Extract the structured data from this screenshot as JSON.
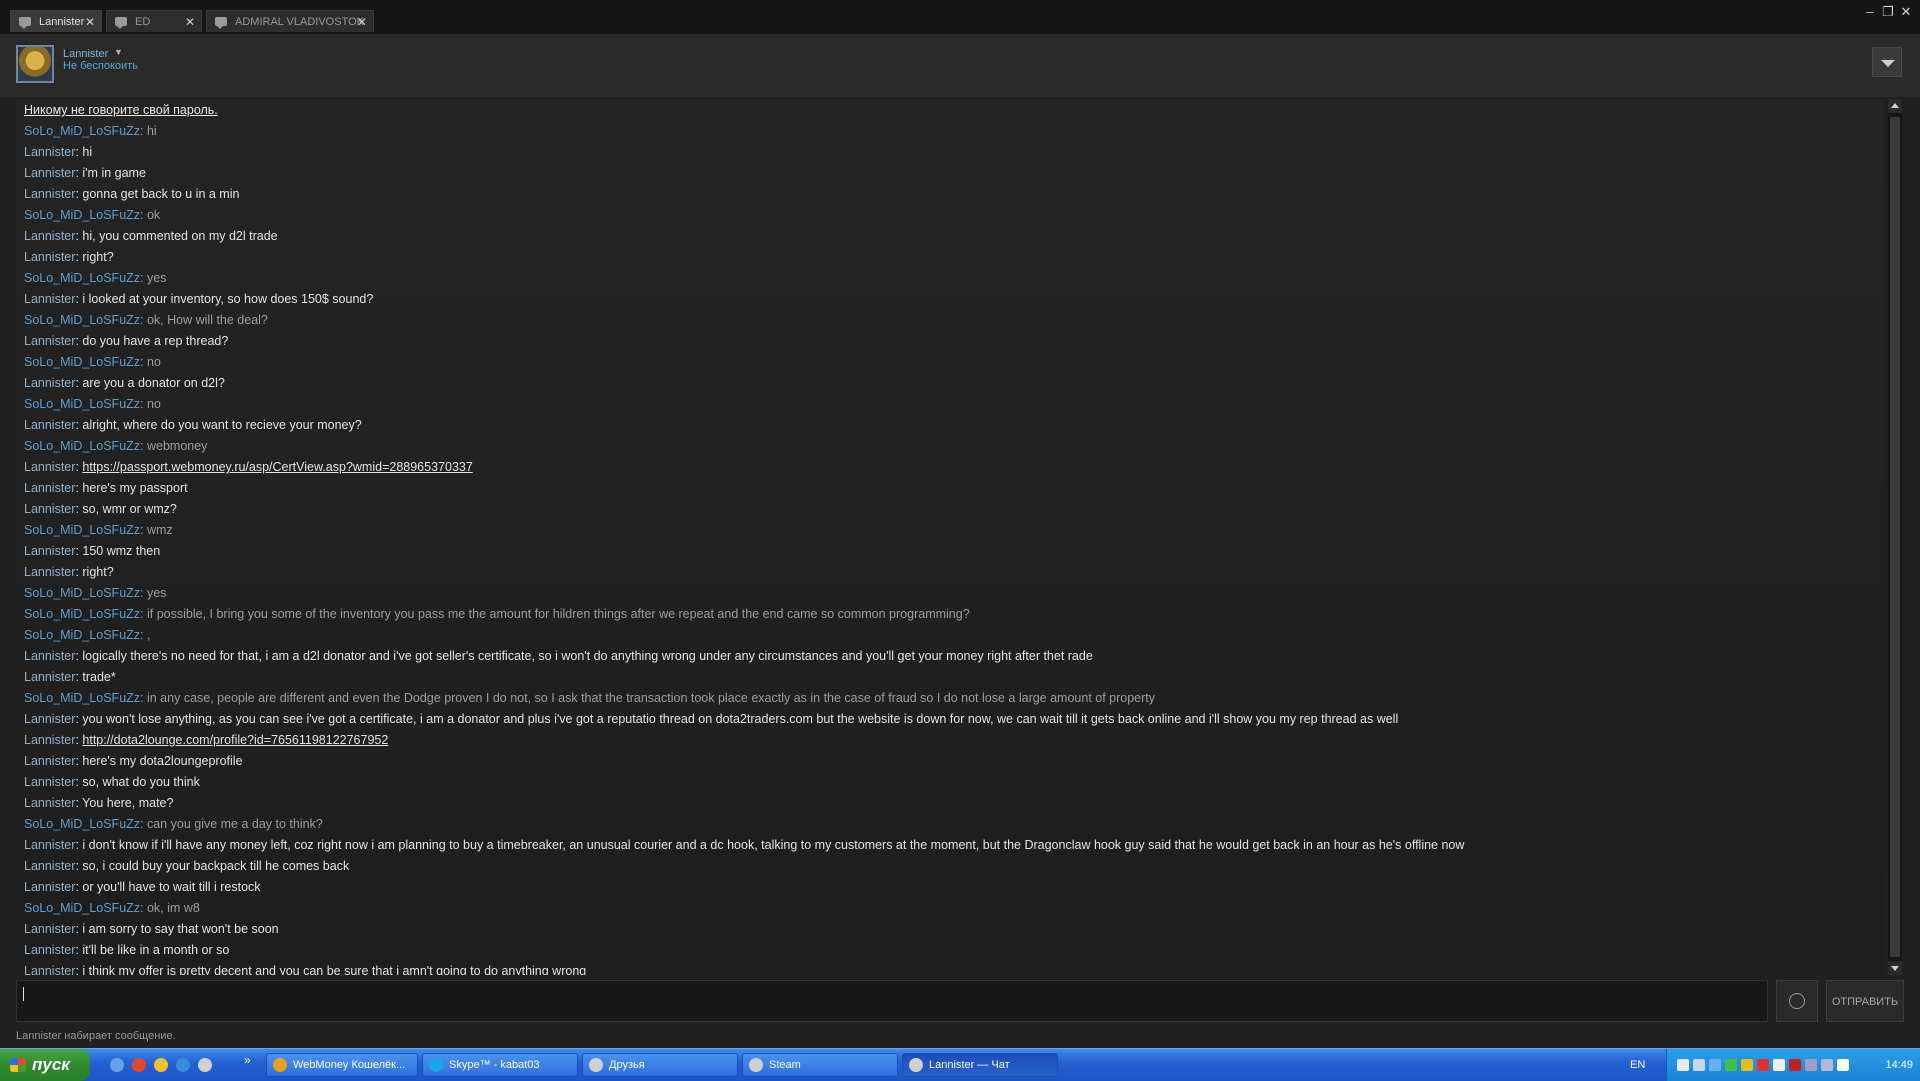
{
  "window": {
    "tabs": [
      {
        "label": "Lannister",
        "active": true
      },
      {
        "label": "ED",
        "active": false
      },
      {
        "label": "ADMIRAL VLADIVOSTOK",
        "active": false
      }
    ],
    "controls": {
      "minimize": "–",
      "maximize": "❐",
      "close": "✕"
    }
  },
  "header": {
    "username": "Lannister",
    "status": "Не беспокоить"
  },
  "chat": {
    "warning": "Никому не говорите свой пароль.",
    "messages": [
      {
        "from": "SoLo_MiD_LoSFuZz",
        "text": "hi"
      },
      {
        "from": "Lannister",
        "text": "hi"
      },
      {
        "from": "Lannister",
        "text": "i'm in game"
      },
      {
        "from": "Lannister",
        "text": "gonna get back to u in a min"
      },
      {
        "from": "SoLo_MiD_LoSFuZz",
        "text": "ok"
      },
      {
        "from": "Lannister",
        "text": "hi, you commented on my d2l trade"
      },
      {
        "from": "Lannister",
        "text": "right?"
      },
      {
        "from": "SoLo_MiD_LoSFuZz",
        "text": "yes"
      },
      {
        "from": "Lannister",
        "text": "i looked at your inventory, so how does 150$ sound?"
      },
      {
        "from": "SoLo_MiD_LoSFuZz",
        "text": "ok, How will the deal?"
      },
      {
        "from": "Lannister",
        "text": "do you have a rep thread?"
      },
      {
        "from": "SoLo_MiD_LoSFuZz",
        "text": "no"
      },
      {
        "from": "Lannister",
        "text": "are you a donator on d2l?"
      },
      {
        "from": "SoLo_MiD_LoSFuZz",
        "text": "no"
      },
      {
        "from": "Lannister",
        "text": "alright, where do you want to recieve your money?"
      },
      {
        "from": "SoLo_MiD_LoSFuZz",
        "text": "webmoney"
      },
      {
        "from": "Lannister",
        "text": "https://passport.webmoney.ru/asp/CertView.asp?wmid=288965370337",
        "link": true
      },
      {
        "from": "Lannister",
        "text": "here's my passport"
      },
      {
        "from": "Lannister",
        "text": "so, wmr or wmz?"
      },
      {
        "from": "SoLo_MiD_LoSFuZz",
        "text": "wmz"
      },
      {
        "from": "Lannister",
        "text": "150 wmz then"
      },
      {
        "from": "Lannister",
        "text": "right?"
      },
      {
        "from": "SoLo_MiD_LoSFuZz",
        "text": "yes"
      },
      {
        "from": "SoLo_MiD_LoSFuZz",
        "text": "if possible, I bring you some of the inventory you pass me the amount for hildren things after we repeat and the end came so common programming?"
      },
      {
        "from": "SoLo_MiD_LoSFuZz",
        "text": ","
      },
      {
        "from": "Lannister",
        "text": "logically there's no need for that, i am a d2l donator and i've got seller's certificate, so i won't do anything wrong under any circumstances and you'll get your money right after thet rade"
      },
      {
        "from": "Lannister",
        "text": "trade*"
      },
      {
        "from": "SoLo_MiD_LoSFuZz",
        "text": "in any case, people are different and even the Dodge proven I do not, so I ask that the transaction took place exactly as in the case of fraud so I do not lose a large amount of property"
      },
      {
        "from": "Lannister",
        "text": "you won't lose anything, as you can see i've got a certificate, i am a donator and plus i've got a reputatio thread on dota2traders.com but the website is down for now, we can wait till it gets back online and i'll show you my rep thread as well"
      },
      {
        "from": "Lannister",
        "text": "http://dota2lounge.com/profile?id=76561198122767952",
        "link": true
      },
      {
        "from": "Lannister",
        "text": "here's my dota2loungeprofile"
      },
      {
        "from": "Lannister",
        "text": "so, what do you think"
      },
      {
        "from": "Lannister",
        "text": "You here, mate?"
      },
      {
        "from": "SoLo_MiD_LoSFuZz",
        "text": "can you give me a day to think?"
      },
      {
        "from": "Lannister",
        "text": "i don't know if i'll have any money left, coz right now i am planning to buy a timebreaker, an unusual courier and a dc hook, talking to my customers at the moment, but the Dragonclaw hook guy said that he would get back in an hour as he's offline now"
      },
      {
        "from": "Lannister",
        "text": "so, i could buy your backpack till he comes back"
      },
      {
        "from": "Lannister",
        "text": "or you'll have to wait till i restock"
      },
      {
        "from": "SoLo_MiD_LoSFuZz",
        "text": "ok, im w8"
      },
      {
        "from": "Lannister",
        "text": "i am sorry to say that won't be soon"
      },
      {
        "from": "Lannister",
        "text": "it'll be like in a month or so"
      },
      {
        "from": "Lannister",
        "text": "i think my offer is pretty decent and you can be sure that i amn't going to do anything wrong"
      }
    ]
  },
  "composer": {
    "send_label": "ОТПРАВИТЬ",
    "typing_status": "Lannister набирает сообщение."
  },
  "taskbar": {
    "start_label": "пуск",
    "more": "»",
    "buttons": [
      {
        "label": "WebMoney Кошелёк...",
        "icon_color": "#e8a020"
      },
      {
        "label": "Skype™ - kabat03",
        "icon_color": "#1aa3e8"
      },
      {
        "label": "Друзья",
        "icon_color": "#d0d0d0"
      },
      {
        "label": "Steam",
        "icon_color": "#d0d0d0"
      },
      {
        "label": "Lannister — Чат",
        "icon_color": "#d0d0d0",
        "active": true
      }
    ],
    "language": "EN",
    "clock": "14:49"
  }
}
